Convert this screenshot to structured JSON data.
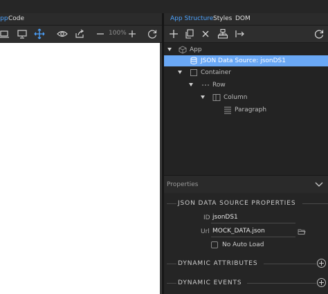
{
  "tabs": {
    "design": "App",
    "code": "Code",
    "app_structure": "App Structure",
    "styles": "Styles",
    "dom": "DOM"
  },
  "toolbar_left": {
    "zoom": "100%",
    "icons": [
      "laptop-icon",
      "desktop-icon",
      "move-icon",
      "eye-icon",
      "share-icon",
      "zoom-out-icon",
      "zoom-in-icon",
      "refresh-icon"
    ]
  },
  "toolbar_right": {
    "icons": [
      "add-icon",
      "copy-icon",
      "delete-icon",
      "structure-icon",
      "insert-after-icon",
      "refresh-icon"
    ]
  },
  "tree": {
    "app": "App",
    "json_source": "JSON Data Source: jsonDS1",
    "container": "Container",
    "row": "Row",
    "column": "Column",
    "paragraph": "Paragraph"
  },
  "properties": {
    "title": "Properties",
    "section": "JSON DATA SOURCE PROPERTIES",
    "id_label": "ID",
    "id_value": "jsonDS1",
    "url_label": "Url",
    "url_value": "MOCK_DATA.json",
    "no_auto_load": "No Auto Load",
    "dynamic_attributes": "DYNAMIC ATTRIBUTES",
    "dynamic_events": "DYNAMIC EVENTS"
  },
  "colors": {
    "accent": "#4da3ff",
    "selected_row": "#6aa8f5",
    "panel": "#232323"
  }
}
